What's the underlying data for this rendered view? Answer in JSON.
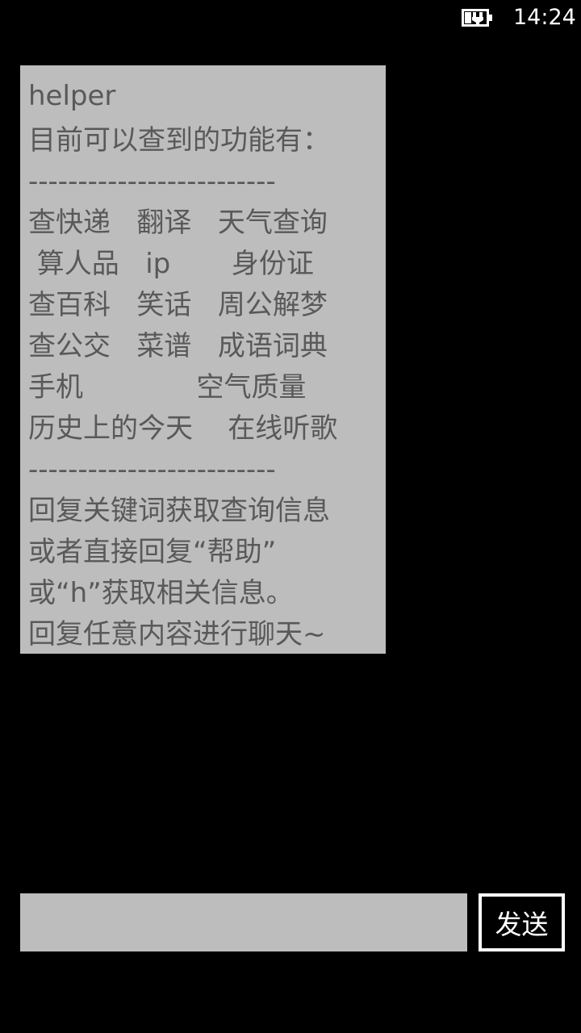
{
  "status_bar": {
    "time": "14:24",
    "battery_icon": "battery-charging-icon"
  },
  "message": {
    "sender": "helper",
    "lines": [
      "目前可以查到的功能有：",
      "-------------------------",
      "查快递   翻译   天气查询",
      " 算人品   ip       身份证",
      "查百科   笑话   周公解梦",
      "查公交   菜谱   成语词典",
      "手机             空气质量",
      "历史上的今天    在线听歌",
      "-------------------------",
      "回复关键词获取查询信息",
      "或者直接回复“帮助”",
      "或“h”获取相关信息。",
      "回复任意内容进行聊天~"
    ]
  },
  "composer": {
    "input_value": "",
    "input_placeholder": "",
    "send_label": "发送"
  },
  "colors": {
    "background": "#000000",
    "bubble": "#bdbdbd",
    "bubble_text": "#595959",
    "input": "#bdbdbd",
    "button_border": "#ffffff"
  }
}
